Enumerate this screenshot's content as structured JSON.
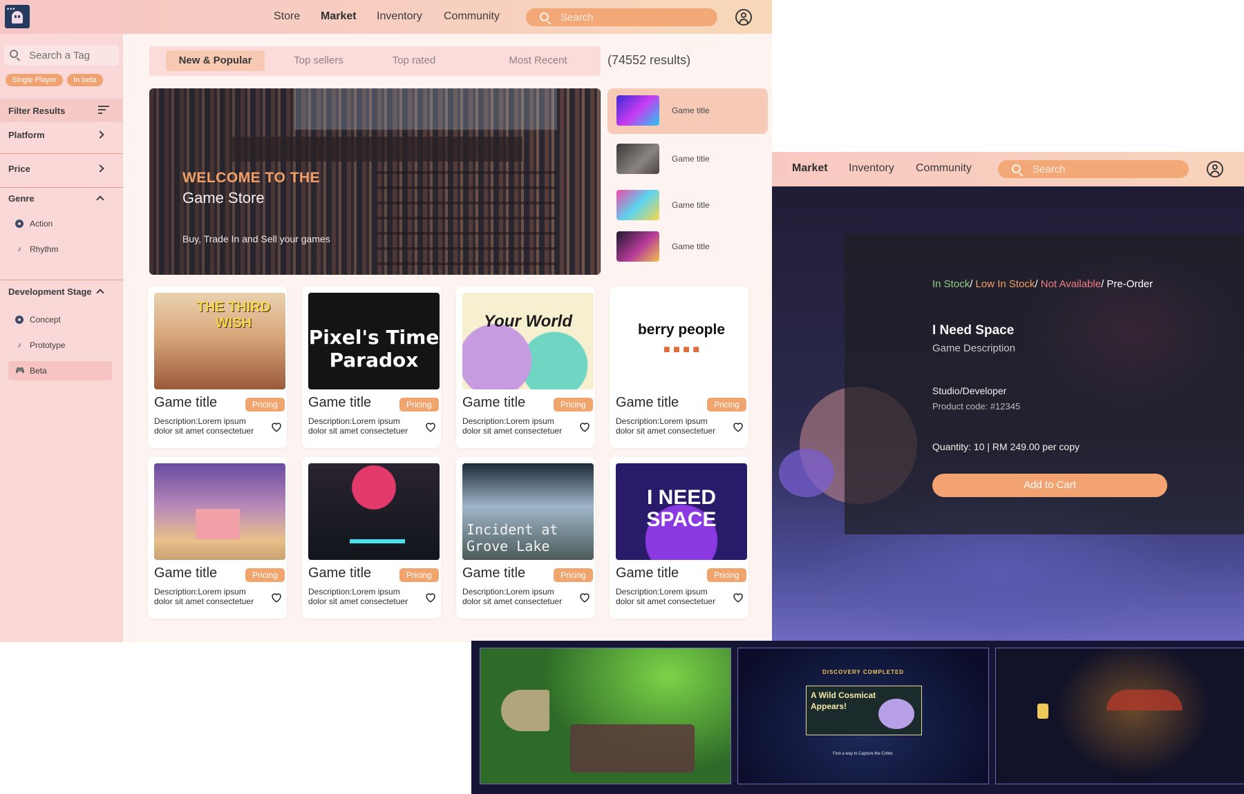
{
  "store": {
    "nav": [
      "Store",
      "Market",
      "Inventory",
      "Community"
    ],
    "search_placeholder": "Search",
    "sidebar": {
      "tag_search_placeholder": "Search a Tag",
      "active_tags": [
        "Single Player",
        "In beta"
      ],
      "filter_results": "Filter Results",
      "platform": "Platform",
      "price": "Price",
      "genre": {
        "label": "Genre",
        "items": [
          "Action",
          "Rhythm"
        ]
      },
      "development_stage": {
        "label": "Development Stage",
        "items": [
          "Concept",
          "Prototype",
          "Beta"
        ]
      }
    },
    "tabs": [
      "New & Popular",
      "Top sellers",
      "Top rated",
      "Most Recent"
    ],
    "results": "(74552 results)",
    "hero": {
      "line1": "WELCOME TO THE",
      "line2": "Game Store",
      "line3": "Buy, Trade In and Sell your games"
    },
    "side_games": [
      "Game title",
      "Game title",
      "Game title",
      "Game title"
    ],
    "cards": [
      {
        "title": "Game title",
        "price": "Pricing",
        "desc": "Description:Lorem ipsum dolor sit amet consectetuer",
        "art": "THE THIRD WISH"
      },
      {
        "title": "Game title",
        "price": "Pricing",
        "desc": "Description:Lorem ipsum dolor sit amet consectetuer",
        "art": "Pixel's Time Paradox"
      },
      {
        "title": "Game title",
        "price": "Pricing",
        "desc": "Description:Lorem ipsum dolor sit amet consectetuer",
        "art": "Your World"
      },
      {
        "title": "Game title",
        "price": "Pricing",
        "desc": "Description:Lorem ipsum dolor sit amet consectetuer",
        "art": "berry people"
      },
      {
        "title": "Game title",
        "price": "Pricing",
        "desc": "Description:Lorem ipsum dolor sit amet consectetuer",
        "art": ""
      },
      {
        "title": "Game title",
        "price": "Pricing",
        "desc": "Description:Lorem ipsum dolor sit amet consectetuer",
        "art": ""
      },
      {
        "title": "Game title",
        "price": "Pricing",
        "desc": "Description:Lorem ipsum dolor sit amet consectetuer",
        "art": "Incident at Grove Lake"
      },
      {
        "title": "Game title",
        "price": "Pricing",
        "desc": "Description:Lorem ipsum dolor sit amet consectetuer",
        "art": "I NEED SPACE"
      }
    ]
  },
  "product": {
    "nav": [
      "Market",
      "Inventory",
      "Community"
    ],
    "search_placeholder": "Search",
    "stock": {
      "in_stock": "In Stock",
      "low": "Low In Stock",
      "na": "Not Available",
      "pre": "Pre-Order",
      "sep": "/ "
    },
    "title": "I Need Space",
    "description": "Game Description",
    "studio": "Studio/Developer",
    "product_code": "Product code: #12345",
    "quantity": "Quantity: 10 | RM 249.00 per copy",
    "add_to_cart": "Add to Cart",
    "colors": {
      "in_stock": "#8fcf8a",
      "low": "#f3a064",
      "na": "#ef7f86",
      "pre": "#ffffff"
    }
  },
  "screenshots": {
    "shot2": {
      "line1": "DISCOVERY COMPLETED",
      "line2": "A Wild Cosmicat",
      "line3": "Appears!",
      "line4": "Find a way to Capture the Critter."
    }
  }
}
